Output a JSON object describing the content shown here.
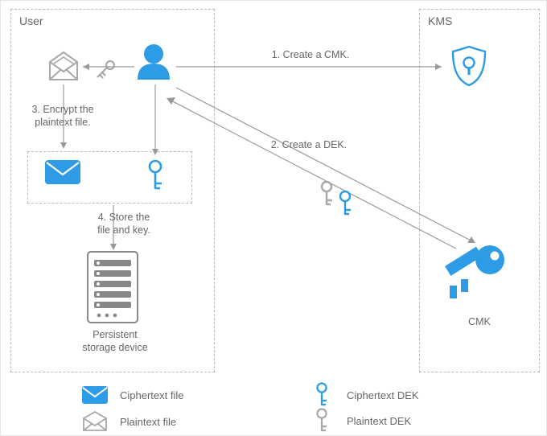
{
  "boxes": {
    "user": {
      "title": "User"
    },
    "kms": {
      "title": "KMS"
    }
  },
  "labels": {
    "step1": "1. Create a CMK.",
    "step2": "2. Create a DEK.",
    "step3": "3. Encrypt the\nplaintext file.",
    "step4": "4. Store the\nfile and key.",
    "storage": "Persistent\nstorage device",
    "cmk": "CMK"
  },
  "legend": {
    "ciphertext_file": "Ciphertext file",
    "plaintext_file": "Plaintext file",
    "ciphertext_dek": "Ciphertext DEK",
    "plaintext_dek": "Plaintext DEK"
  },
  "colors": {
    "blue": "#2e9be6",
    "gray": "#a8a8a8",
    "text": "#666666"
  }
}
